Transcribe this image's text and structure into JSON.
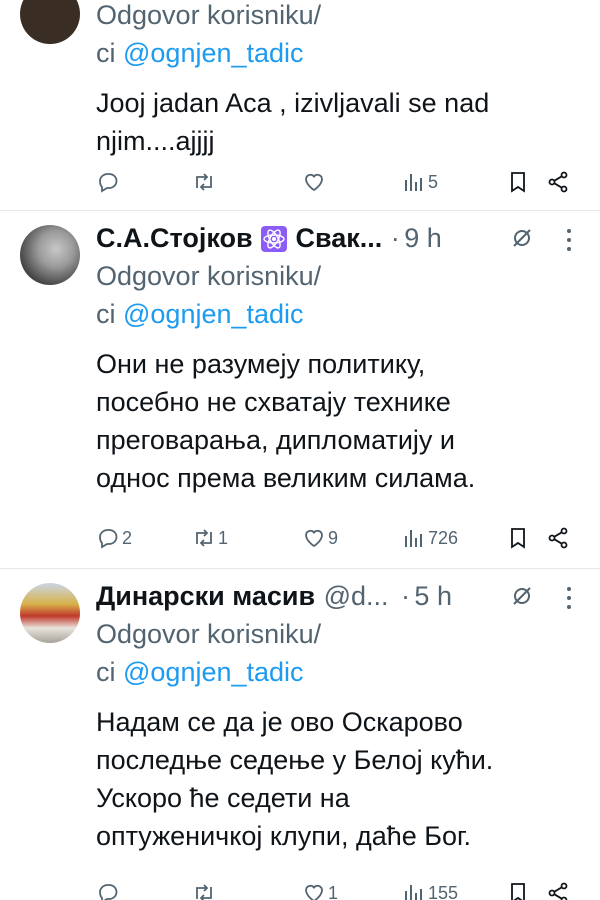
{
  "tweets": [
    {
      "reply_label": "Odgovor korisniku/",
      "reply_prefix": "ci ",
      "reply_handle": "@ognjen_tadic",
      "text": [
        "Jooj jadan Aca , izivljavali se nad",
        "njim....ajjjj"
      ],
      "counts": {
        "reply": "",
        "retweet": "",
        "like": "",
        "views": "5"
      }
    },
    {
      "name": "С.А.Стојков",
      "name_rest": "Свак...",
      "dot": "·",
      "time": "9 h",
      "reply_label": "Odgovor korisniku/",
      "reply_prefix": "ci ",
      "reply_handle": "@ognjen_tadic",
      "text": [
        "Они не разумеју политику,",
        "посебно не схватају технике",
        "преговарања, дипломатију и",
        "однос према великим силама."
      ],
      "counts": {
        "reply": "2",
        "retweet": "1",
        "like": "9",
        "views": "726"
      }
    },
    {
      "name": "Динарски масив",
      "handle": "@d...",
      "dot": "·",
      "time": "5 h",
      "reply_label": "Odgovor korisniku/",
      "reply_prefix": "ci ",
      "reply_handle": "@ognjen_tadic",
      "text": [
        "Надам се да је ово Оскарово",
        "последње седење у Белој кући.",
        "Ускоро ће седети на",
        "оптуженичкој клупи, даће Бог."
      ],
      "counts": {
        "reply": "",
        "retweet": "",
        "like": "1",
        "views": "155"
      }
    }
  ],
  "colors": {
    "link": "#1d9bf0",
    "secondary": "#536471",
    "text": "#0f1419",
    "badge": "#8b5cf6"
  },
  "icons": [
    "reply-icon",
    "retweet-icon",
    "like-icon",
    "views-icon",
    "bookmark-icon",
    "share-icon",
    "grok-icon",
    "more-icon",
    "atom-badge-icon"
  ]
}
